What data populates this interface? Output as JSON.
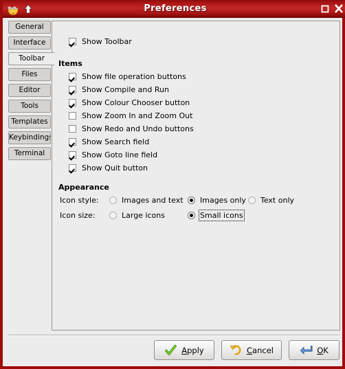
{
  "window": {
    "title": "Preferences",
    "app_icon": "geany-icon",
    "up_arrow": "up-arrow-icon",
    "maximize": "maximize-icon",
    "close": "close-icon",
    "accent_titlebar": "#c22626",
    "border_color": "#9e0c0c",
    "background": "#ececec"
  },
  "tabs": [
    {
      "label": "General",
      "active": false
    },
    {
      "label": "Interface",
      "active": false
    },
    {
      "label": "Toolbar",
      "active": true
    },
    {
      "label": "Files",
      "active": false
    },
    {
      "label": "Editor",
      "active": false
    },
    {
      "label": "Tools",
      "active": false
    },
    {
      "label": "Templates",
      "active": false
    },
    {
      "label": "Keybindings",
      "active": false
    },
    {
      "label": "Terminal",
      "active": false
    }
  ],
  "panel": {
    "show_toolbar": {
      "label": "Show Toolbar",
      "checked": true
    },
    "items_heading": "Items",
    "items": [
      {
        "label": "Show file operation buttons",
        "checked": true
      },
      {
        "label": "Show Compile and Run",
        "checked": true
      },
      {
        "label": "Show Colour Chooser button",
        "checked": true
      },
      {
        "label": "Show Zoom In and Zoom Out",
        "checked": false
      },
      {
        "label": "Show Redo and Undo buttons",
        "checked": false
      },
      {
        "label": "Show Search field",
        "checked": true
      },
      {
        "label": "Show Goto line field",
        "checked": true
      },
      {
        "label": "Show Quit button",
        "checked": true
      }
    ],
    "appearance_heading": "Appearance",
    "icon_style": {
      "label": "Icon style:",
      "options": [
        {
          "label": "Images and text",
          "selected": false,
          "focused": false
        },
        {
          "label": "Images only",
          "selected": true,
          "focused": false
        },
        {
          "label": "Text only",
          "selected": false,
          "focused": false
        }
      ]
    },
    "icon_size": {
      "label": "Icon size:",
      "options": [
        {
          "label": "Large icons",
          "selected": false,
          "focused": false
        },
        {
          "label": "Small icons",
          "selected": true,
          "focused": true
        }
      ]
    }
  },
  "buttons": {
    "apply": {
      "prefix": "",
      "mnemonic": "A",
      "suffix": "pply",
      "icon": "green-check-icon"
    },
    "cancel": {
      "prefix": "",
      "mnemonic": "C",
      "suffix": "ancel",
      "icon": "yellow-undo-arrow-icon"
    },
    "ok": {
      "prefix": "",
      "mnemonic": "O",
      "suffix": "K",
      "icon": "blue-enter-arrow-icon"
    }
  }
}
